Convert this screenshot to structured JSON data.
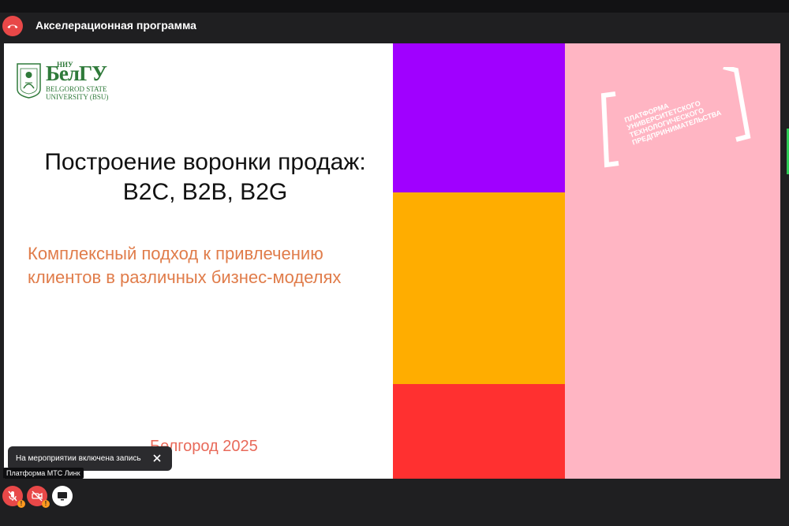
{
  "header": {
    "title": "Акселерационная программа"
  },
  "slide": {
    "logo": {
      "small": "НИУ",
      "big": "БелГУ",
      "line1": "BELGOROD STATE",
      "line2": "UNIVERSITY (BSU)"
    },
    "title_line1": "Построение воронки продаж:",
    "title_line2": "B2C, B2B, B2G",
    "subtitle_line1": "Комплексный подход к привлечению",
    "subtitle_line2": "клиентов в различных бизнес-моделях",
    "city": "Белгород 2025",
    "platform_lines": [
      "ПЛАТФОРМА",
      "УНИВЕРСИТЕТСКОГО",
      "ТЕХНОЛОГИЧЕСКОГО",
      "ПРЕДПРИНИМАТЕЛЬСТВА"
    ]
  },
  "notification": {
    "text": "На мероприятии включена запись"
  },
  "tooltip": {
    "text": "Платформа МТС Линк"
  },
  "colors": {
    "purple": "#a000ff",
    "orange": "#ffad00",
    "red": "#ff3030",
    "pink": "#ffb5c3",
    "accent_red": "#e84848",
    "logo_green": "#2f7a3a"
  },
  "controls": {
    "warning_mark": "!"
  }
}
